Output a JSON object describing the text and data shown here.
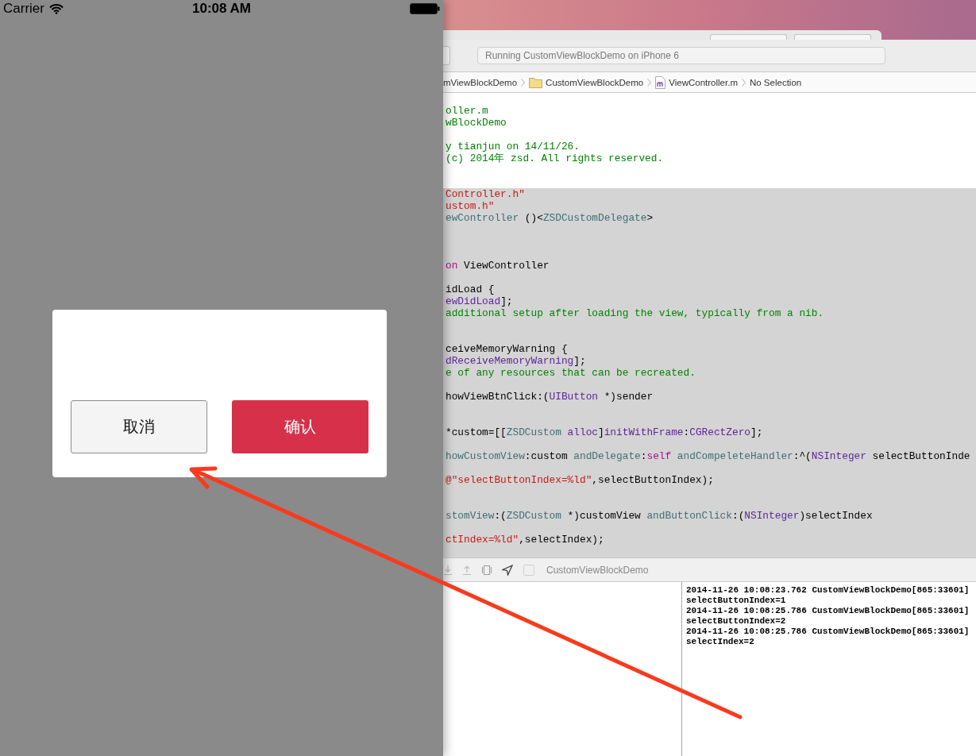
{
  "simulator": {
    "status_bar": {
      "carrier": "Carrier",
      "time": "10:08 AM"
    },
    "dialog": {
      "buttons": [
        {
          "label": "取消",
          "kind": "secondary"
        },
        {
          "label": "确认",
          "kind": "primary"
        }
      ]
    }
  },
  "xcode": {
    "activity": "Running CustomViewBlockDemo on iPhone 6",
    "breadcrumbs": [
      {
        "label": "mViewBlockDemo",
        "kind": "project"
      },
      {
        "label": "CustomViewBlockDemo",
        "kind": "folder"
      },
      {
        "label": "ViewController.m",
        "kind": "file"
      },
      {
        "label": "No Selection",
        "kind": "plain"
      }
    ],
    "code_lines": [
      {
        "highlighted": false,
        "tokens": [
          {
            "text": "oller.m",
            "kind": "comment"
          }
        ]
      },
      {
        "highlighted": false,
        "tokens": [
          {
            "text": "wBlockDemo",
            "kind": "comment"
          }
        ]
      },
      {
        "highlighted": false
      },
      {
        "highlighted": false,
        "tokens": [
          {
            "text": "y tianjun on 14/11/26.",
            "kind": "comment"
          }
        ]
      },
      {
        "highlighted": false,
        "tokens": [
          {
            "text": "(c) 2014年 zsd. All rights reserved.",
            "kind": "comment"
          }
        ]
      },
      {
        "highlighted": false
      },
      {
        "highlighted": false
      },
      {
        "highlighted": true,
        "tokens": [
          {
            "text": "Controller.h\"",
            "kind": "string"
          }
        ]
      },
      {
        "highlighted": true,
        "tokens": [
          {
            "text": "ustom.h\"",
            "kind": "string"
          }
        ]
      },
      {
        "highlighted": true,
        "tokens": [
          {
            "text": "ewController",
            "kind": "type"
          },
          {
            "text": " ()<",
            "kind": "plain"
          },
          {
            "text": "ZSDCustomDelegate",
            "kind": "type"
          },
          {
            "text": ">",
            "kind": "plain"
          }
        ]
      },
      {
        "highlighted": true
      },
      {
        "highlighted": true
      },
      {
        "highlighted": true
      },
      {
        "highlighted": true,
        "tokens": [
          {
            "text": "on",
            "kind": "keyword"
          },
          {
            "text": " ViewController",
            "kind": "plain"
          }
        ]
      },
      {
        "highlighted": true
      },
      {
        "highlighted": true,
        "tokens": [
          {
            "text": "idLoad {",
            "kind": "plain"
          }
        ]
      },
      {
        "highlighted": true,
        "tokens": [
          {
            "text": "ewDidLoad",
            "kind": "system"
          },
          {
            "text": "];",
            "kind": "plain"
          }
        ]
      },
      {
        "highlighted": true,
        "tokens": [
          {
            "text": "additional setup after loading the view, typically from a nib.",
            "kind": "comment"
          }
        ]
      },
      {
        "highlighted": true
      },
      {
        "highlighted": true
      },
      {
        "highlighted": true,
        "tokens": [
          {
            "text": "ceiveMemoryWarning {",
            "kind": "plain"
          }
        ]
      },
      {
        "highlighted": true,
        "tokens": [
          {
            "text": "dReceiveMemoryWarning",
            "kind": "system"
          },
          {
            "text": "];",
            "kind": "plain"
          }
        ]
      },
      {
        "highlighted": true,
        "tokens": [
          {
            "text": "e of any resources that can be recreated.",
            "kind": "comment"
          }
        ]
      },
      {
        "highlighted": true
      },
      {
        "highlighted": true,
        "tokens": [
          {
            "text": "howViewBtnClick:(",
            "kind": "plain"
          },
          {
            "text": "UIButton",
            "kind": "system"
          },
          {
            "text": " *)sender",
            "kind": "plain"
          }
        ]
      },
      {
        "highlighted": true
      },
      {
        "highlighted": true
      },
      {
        "highlighted": true,
        "tokens": [
          {
            "text": "*custom=[[",
            "kind": "plain"
          },
          {
            "text": "ZSDCustom",
            "kind": "type"
          },
          {
            "text": " alloc",
            "kind": "system"
          },
          {
            "text": "]",
            "kind": "plain"
          },
          {
            "text": "initWithFrame",
            "kind": "system"
          },
          {
            "text": ":",
            "kind": "plain"
          },
          {
            "text": "CGRectZero",
            "kind": "system"
          },
          {
            "text": "];",
            "kind": "plain"
          }
        ]
      },
      {
        "highlighted": true
      },
      {
        "highlighted": true,
        "tokens": [
          {
            "text": "howCustomView",
            "kind": "type"
          },
          {
            "text": ":custom ",
            "kind": "plain"
          },
          {
            "text": "andDelegate",
            "kind": "type"
          },
          {
            "text": ":",
            "kind": "plain"
          },
          {
            "text": "self",
            "kind": "keyword"
          },
          {
            "text": " andCompeleteHandler",
            "kind": "type"
          },
          {
            "text": ":^(",
            "kind": "plain"
          },
          {
            "text": "NSInteger",
            "kind": "system"
          },
          {
            "text": " selectButtonInde",
            "kind": "plain"
          }
        ]
      },
      {
        "highlighted": true
      },
      {
        "highlighted": true,
        "tokens": [
          {
            "text": "@\"selectButtonIndex=%ld\"",
            "kind": "string"
          },
          {
            "text": ",selectButtonIndex);",
            "kind": "plain"
          }
        ]
      },
      {
        "highlighted": true
      },
      {
        "highlighted": true
      },
      {
        "highlighted": true,
        "tokens": [
          {
            "text": "stomView",
            "kind": "type"
          },
          {
            "text": ":(",
            "kind": "plain"
          },
          {
            "text": "ZSDCustom",
            "kind": "type"
          },
          {
            "text": " *)customView ",
            "kind": "plain"
          },
          {
            "text": "andButtonClick",
            "kind": "type"
          },
          {
            "text": ":(",
            "kind": "plain"
          },
          {
            "text": "NSInteger",
            "kind": "system"
          },
          {
            "text": ")selectIndex",
            "kind": "plain"
          }
        ]
      },
      {
        "highlighted": true
      },
      {
        "highlighted": true,
        "tokens": [
          {
            "text": "ctIndex=%ld\"",
            "kind": "string"
          },
          {
            "text": ",selectIndex);",
            "kind": "plain"
          }
        ]
      },
      {
        "highlighted": true
      }
    ],
    "debug_bar": {
      "target": "CustomViewBlockDemo"
    },
    "console": [
      "2014-11-26 10:08:23.762 CustomViewBlockDemo[865:33601]",
      "selectButtonIndex=1",
      "2014-11-26 10:08:25.786 CustomViewBlockDemo[865:33601]",
      "selectButtonIndex=2",
      "2014-11-26 10:08:25.786 CustomViewBlockDemo[865:33601]",
      "selectIndex=2"
    ]
  }
}
